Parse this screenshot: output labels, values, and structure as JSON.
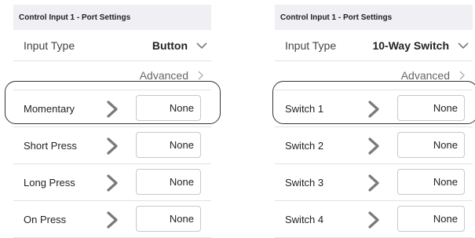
{
  "panels": [
    {
      "header": "Control Input 1 - Port Settings",
      "input_type_label": "Input Type",
      "input_type_value": "Button",
      "advanced_label": "Advanced",
      "rows": [
        {
          "label": "Momentary",
          "value": "None"
        },
        {
          "label": "Short Press",
          "value": "None"
        },
        {
          "label": "Long Press",
          "value": "None"
        },
        {
          "label": "On Press",
          "value": "None"
        }
      ]
    },
    {
      "header": "Control Input 1 - Port Settings",
      "input_type_label": "Input Type",
      "input_type_value": "10-Way Switch",
      "advanced_label": "Advanced",
      "rows": [
        {
          "label": "Switch 1",
          "value": "None"
        },
        {
          "label": "Switch 2",
          "value": "None"
        },
        {
          "label": "Switch 3",
          "value": "None"
        },
        {
          "label": "Switch 4",
          "value": "None"
        }
      ]
    }
  ],
  "icons": {
    "dropdown": "chevron-down-icon",
    "advanced": "chevron-right-icon",
    "row_arrow": "chevron-right-icon"
  },
  "colors": {
    "header_bg": "#efeff4",
    "chevron": "#7a7a7a",
    "divider": "#e2e2e6",
    "highlight_outline": "#333333"
  }
}
